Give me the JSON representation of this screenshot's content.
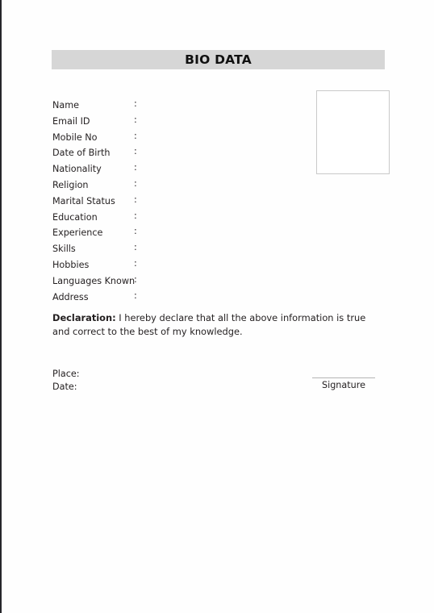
{
  "document": {
    "title": "BIO DATA"
  },
  "photo_box": {
    "label": ""
  },
  "fields": [
    {
      "label": "Name",
      "separator": ":",
      "value": ""
    },
    {
      "label": "Email ID",
      "separator": ":",
      "value": ""
    },
    {
      "label": "Mobile No",
      "separator": ":",
      "value": ""
    },
    {
      "label": "Date of Birth",
      "separator": ":",
      "value": ""
    },
    {
      "label": "Nationality",
      "separator": ":",
      "value": ""
    },
    {
      "label": "Religion",
      "separator": ":",
      "value": ""
    },
    {
      "label": "Marital Status",
      "separator": ":",
      "value": ""
    },
    {
      "label": "Education",
      "separator": ":",
      "value": ""
    },
    {
      "label": "Experience",
      "separator": ":",
      "value": ""
    },
    {
      "label": "Skills",
      "separator": ":",
      "value": ""
    },
    {
      "label": "Hobbies",
      "separator": ":",
      "value": ""
    },
    {
      "label": "Languages Known",
      "separator": ":",
      "value": ""
    },
    {
      "label": "Address",
      "separator": ":",
      "value": ""
    }
  ],
  "declaration": {
    "heading": "Declaration:",
    "body": " I hereby declare that all the above information is true and correct to the best of my knowledge."
  },
  "footer": {
    "place_label": "Place:",
    "place_value": "",
    "date_label": "Date:",
    "date_value": "",
    "signature_caption": "Signature"
  },
  "colors": {
    "title_bar": "#d6d6d6",
    "text": "#231f20",
    "page_border": "#26262b",
    "photo_border": "#c9c9c9",
    "signature_line": "#b5b5b5"
  }
}
